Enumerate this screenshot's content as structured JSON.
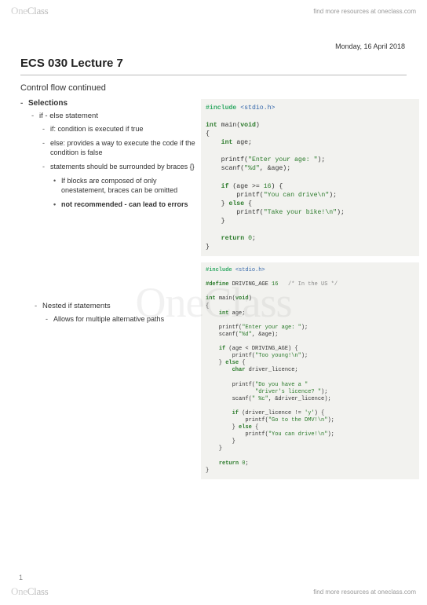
{
  "brand": {
    "one": "One",
    "class": "Class"
  },
  "resource_text": "find more resources at oneclass.com",
  "date": "Monday, 16 April 2018",
  "title": "ECS 030 Lecture 7",
  "subtitle": "Control flow continued",
  "bullets": {
    "selections": "Selections",
    "ifelse": "if - else statement",
    "if_desc": "if: condition is executed if true",
    "else_desc": "else: provides a way to execute the code if the condition is false",
    "braces": "statements should be surrounded by braces {}",
    "omit": "If blocks are composed of only onestatement, braces can be omitted",
    "not_rec": "not recommended - can lead to errors",
    "nested": "Nested if statements",
    "nested_desc": "Allows for multiple alternative paths"
  },
  "page_number": "1",
  "chart_data": null
}
